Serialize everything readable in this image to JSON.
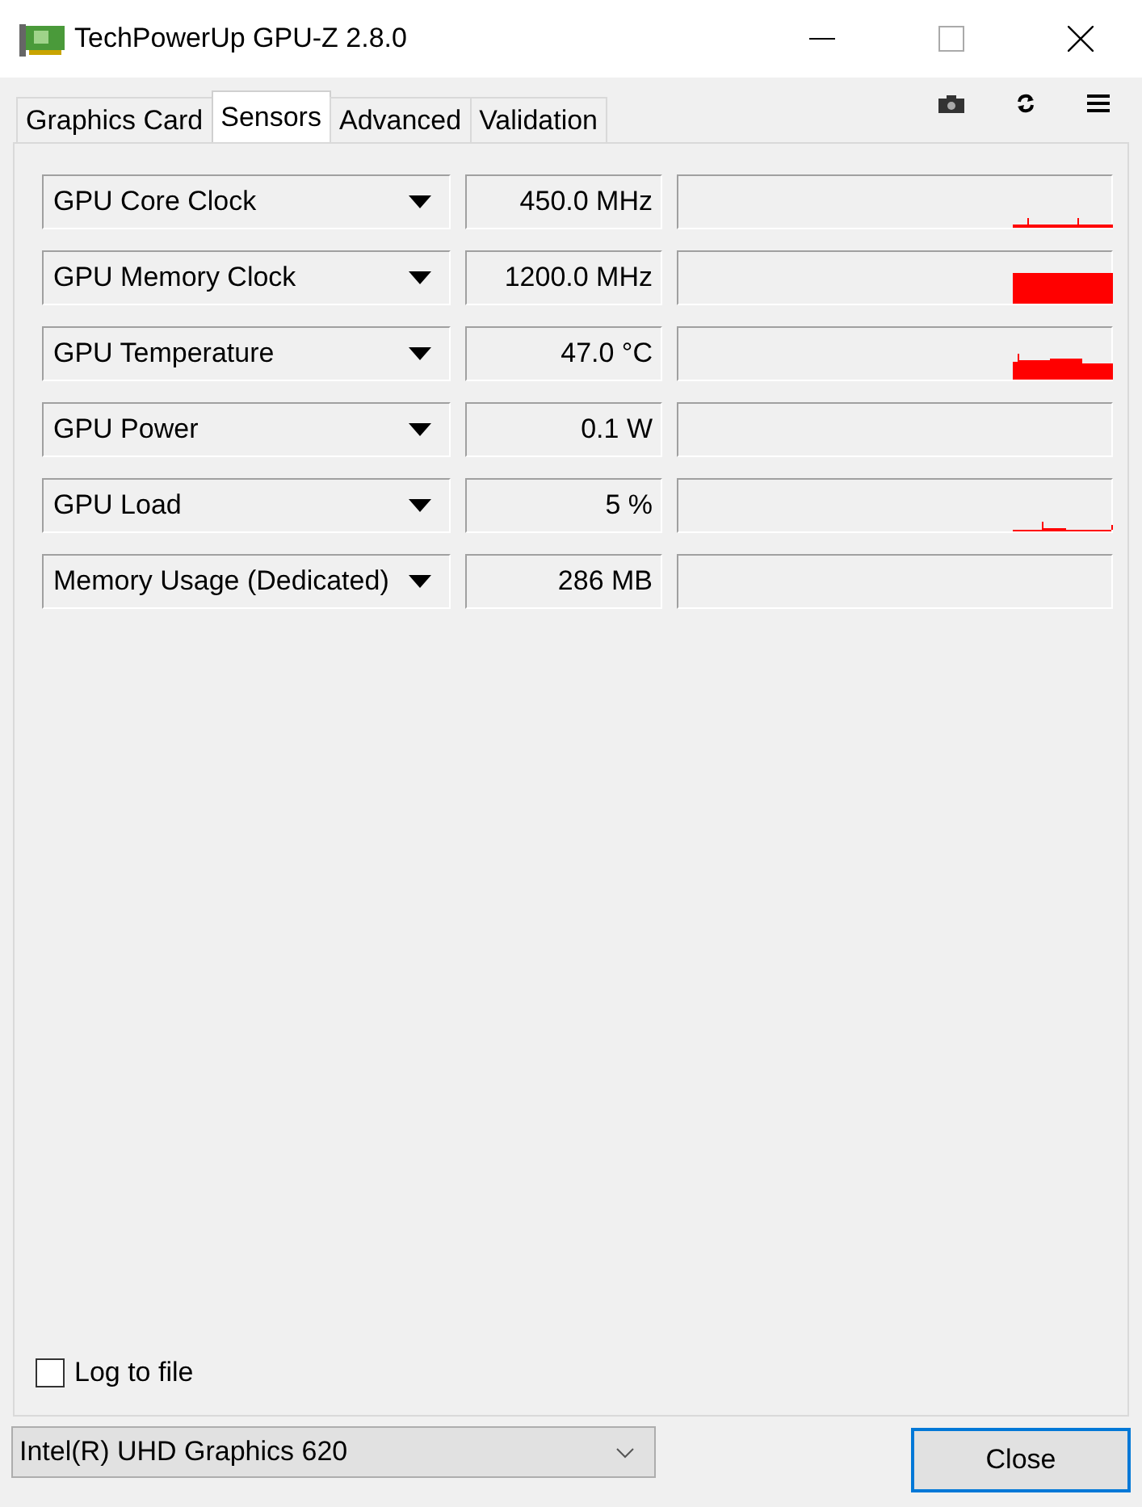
{
  "window": {
    "title": "TechPowerUp GPU-Z 2.8.0"
  },
  "tabs": [
    {
      "label": "Graphics Card",
      "selected": false
    },
    {
      "label": "Sensors",
      "selected": true
    },
    {
      "label": "Advanced",
      "selected": false
    },
    {
      "label": "Validation",
      "selected": false
    }
  ],
  "sensors": [
    {
      "name": "GPU Core Clock",
      "reading": "450.0 MHz"
    },
    {
      "name": "GPU Memory Clock",
      "reading": "1200.0 MHz"
    },
    {
      "name": "GPU Temperature",
      "reading": "47.0 °C"
    },
    {
      "name": "GPU Power",
      "reading": "0.1 W"
    },
    {
      "name": "GPU Load",
      "reading": "5 %"
    },
    {
      "name": "Memory Usage (Dedicated)",
      "reading": "286 MB"
    }
  ],
  "log_to_file": {
    "label": "Log to file",
    "checked": false
  },
  "gpu_select": {
    "value": "Intel(R) UHD Graphics 620"
  },
  "buttons": [
    "Close"
  ]
}
